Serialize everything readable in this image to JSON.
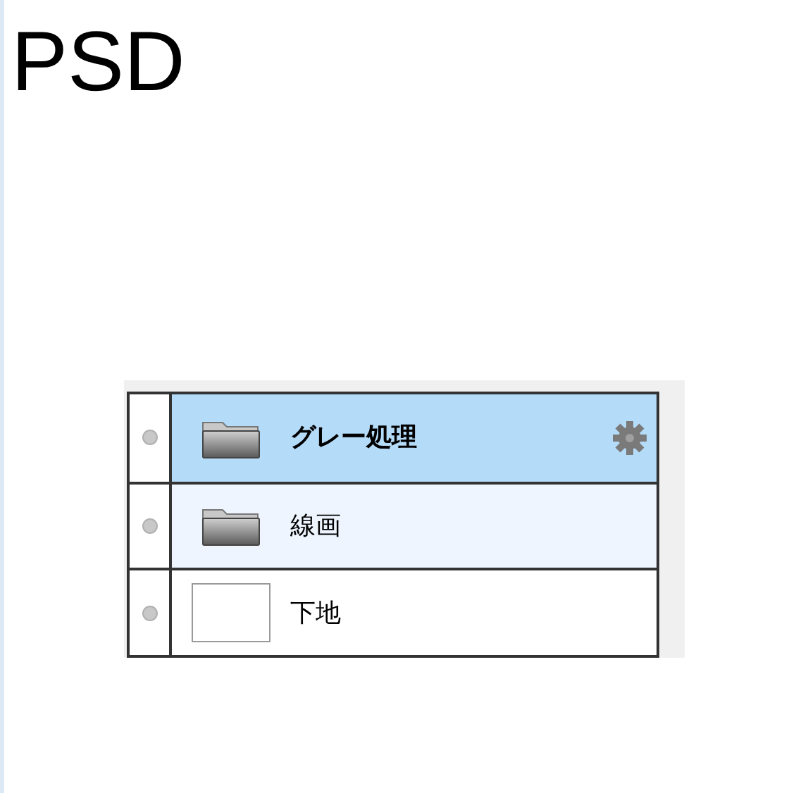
{
  "heading": "PSD",
  "layers": [
    {
      "name": "グレー処理",
      "kind": "folder",
      "selected": true,
      "hovered": false,
      "bold": true
    },
    {
      "name": "線画",
      "kind": "folder",
      "selected": false,
      "hovered": true,
      "bold": false
    },
    {
      "name": "下地",
      "kind": "raster",
      "selected": false,
      "hovered": false,
      "bold": false
    }
  ]
}
